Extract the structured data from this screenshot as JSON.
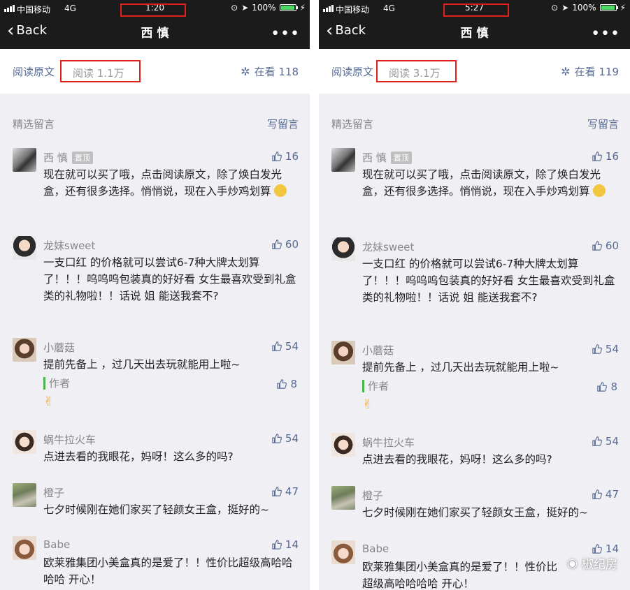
{
  "status_bar": {
    "carrier": "中国移动",
    "network": "4G",
    "battery_percent": "100%"
  },
  "colors": {
    "accent": "#576b95",
    "highlight_box": "#e0201b",
    "nav_bg": "#1b1b1b",
    "battery": "#4cd964"
  },
  "icons": [
    "signal-icon",
    "location-arrow-icon",
    "battery-icon",
    "chevron-left-icon",
    "more-icon",
    "gear-icon",
    "thumb-up-icon",
    "victory-hand-icon",
    "smiley-icon",
    "wechat-icon"
  ],
  "screens": [
    {
      "time": "1:20",
      "nav": {
        "back_label": "Back",
        "title": "西  慎",
        "more": "•••"
      },
      "read_bar": {
        "read_original": "阅读原文",
        "read_count": "阅读 1.1万",
        "watching": "在看 118"
      },
      "comments_header": {
        "title": "精选留言",
        "write": "写留言"
      },
      "comments": [
        {
          "name": "西  慎",
          "badge": "置顶",
          "likes": "16",
          "text": "现在就可以买了哦，点击阅读原文，除了焕白发光盒，还有很多选择。悄悄说，现在入手炒鸡划算"
        },
        {
          "name": "龙妹sweet",
          "likes": "60",
          "text": "一支口红   的价格就可以尝试6-7种大牌太划算了！！！呜呜呜包装真的好好看 女生最喜欢受到礼盒类的礼物啦！！话说 姐 能送我套不?"
        },
        {
          "name": "小蘑菇",
          "likes": "54",
          "text": "提前先备上   ，过几天出去玩就能用上啦~",
          "reply": {
            "label": "作者",
            "likes": "8"
          }
        },
        {
          "name": "蜗牛拉火车",
          "likes": "54",
          "text": "点进去看的我眼花，妈呀！这么多的吗?"
        },
        {
          "name": "橙子",
          "likes": "47",
          "text": "七夕时候刚在她们家买了轻颜女王盒，挺好的~"
        },
        {
          "name": "Babe",
          "likes": "14",
          "text": "欧莱雅集团小美盒真的是爱了！！性价比超级高哈哈哈哈 开心！"
        }
      ]
    },
    {
      "time": "5:27",
      "nav": {
        "back_label": "Back",
        "title": "西  慎",
        "more": "•••"
      },
      "read_bar": {
        "read_original": "阅读原文",
        "read_count": "阅读 3.1万",
        "watching": "在看 119"
      },
      "comments_header": {
        "title": "精选留言",
        "write": "写留言"
      },
      "comments": [
        {
          "name": "西  慎",
          "badge": "置顶",
          "likes": "16",
          "text": "现在就可以买了哦，点击阅读原文，除了焕白发光盒，还有很多选择。悄悄说，现在入手炒鸡划算"
        },
        {
          "name": "龙妹sweet",
          "likes": "60",
          "text": "一支口红   的价格就可以尝试6-7种大牌太划算了！！！呜呜呜包装真的好好看 女生最喜欢受到礼盒类的礼物啦！！话说 姐 能送我套不?"
        },
        {
          "name": "小蘑菇",
          "likes": "54",
          "text": "提前先备上   ，过几天出去玩就能用上啦~",
          "reply": {
            "label": "作者",
            "likes": "8"
          }
        },
        {
          "name": "蜗牛拉火车",
          "likes": "54",
          "text": "点进去看的我眼花，妈呀！这么多的吗?"
        },
        {
          "name": "橙子",
          "likes": "47",
          "text": "七夕时候刚在她们家买了轻颜女王盒，挺好的~"
        },
        {
          "name": "Babe",
          "likes": "14",
          "text": "欧莱雅集团小美盒真的是爱了！！性价比超级高哈哈哈哈 开心！"
        }
      ]
    }
  ],
  "watermark": "椒纪房"
}
